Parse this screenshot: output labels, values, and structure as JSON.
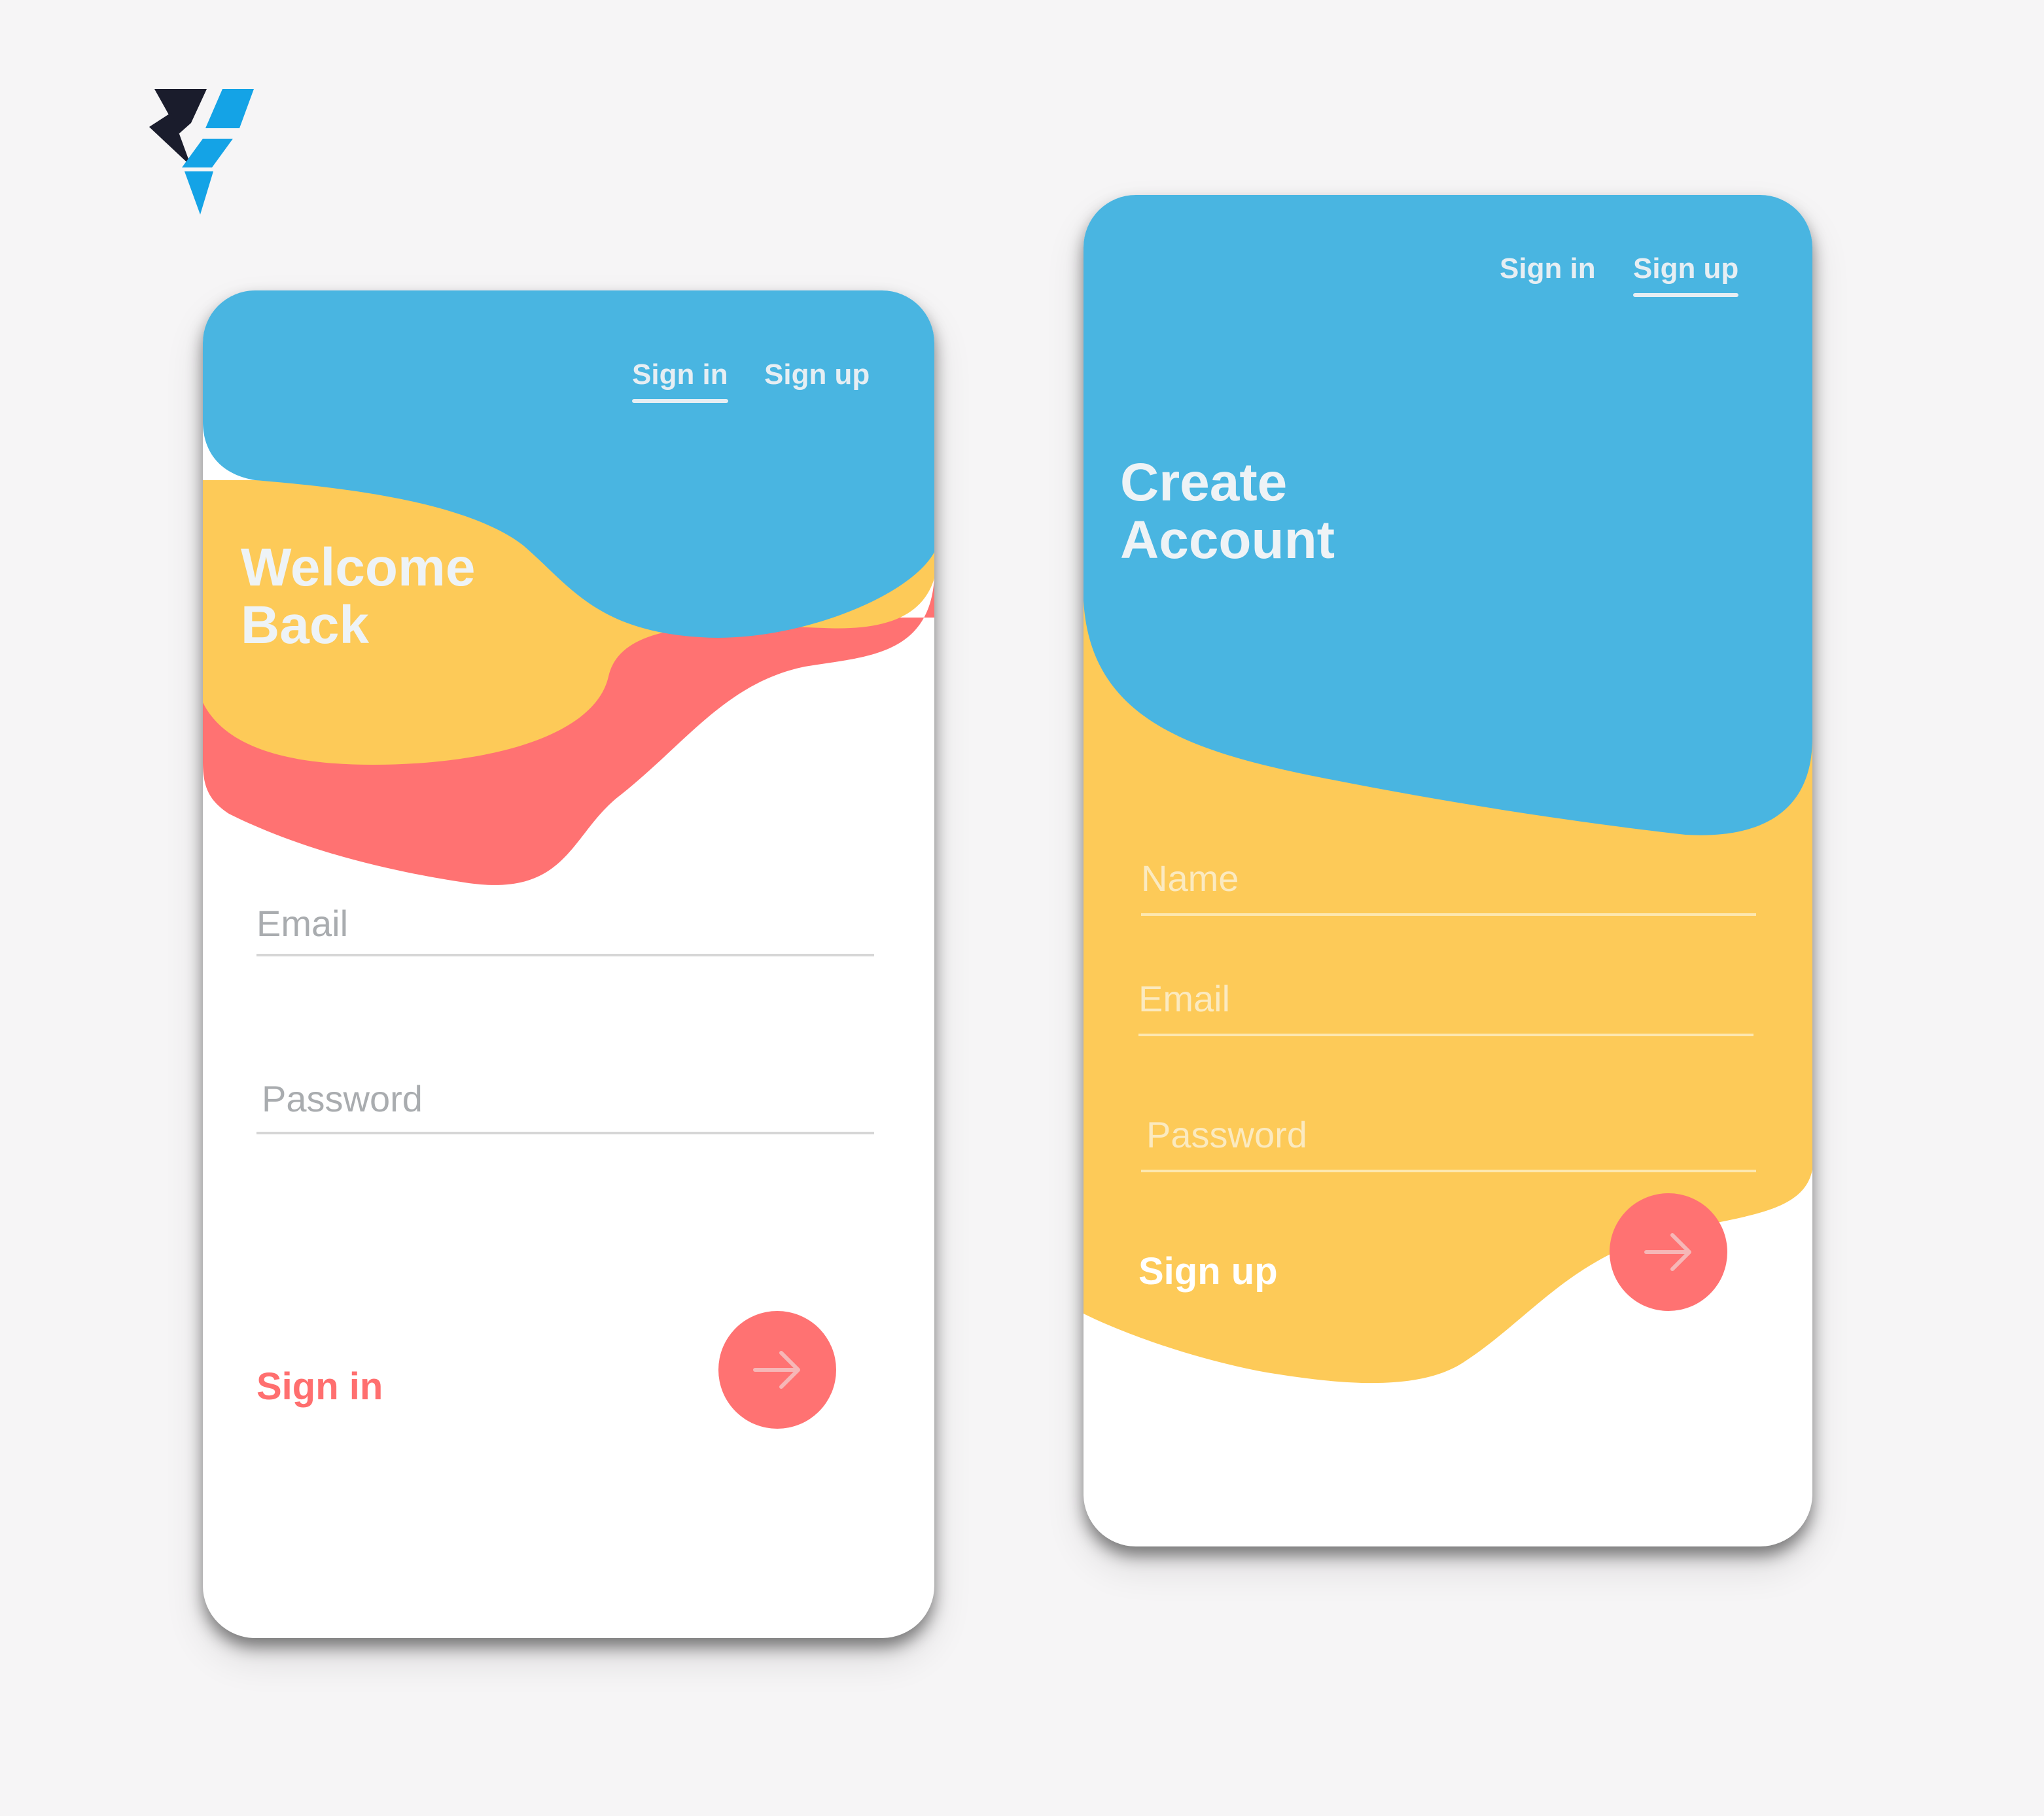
{
  "brand": {
    "logo_icon": "brand-logo-icon",
    "colors": {
      "dark": "#1a1c2c",
      "blue": "#14a3e6"
    }
  },
  "palette": {
    "blue": "#49b5e1",
    "yellow": "#fdca58",
    "coral": "#ff7272",
    "white": "#ffffff"
  },
  "signin_screen": {
    "nav": {
      "signin": "Sign in",
      "signup": "Sign up",
      "active": "signin"
    },
    "headline": [
      "Welcome",
      "Back"
    ],
    "email": {
      "placeholder": "Email",
      "value": ""
    },
    "password": {
      "placeholder": "Password",
      "value": ""
    },
    "action_label": "Sign in",
    "submit_icon": "arrow-right-icon"
  },
  "signup_screen": {
    "nav": {
      "signin": "Sign in",
      "signup": "Sign up",
      "active": "signup"
    },
    "headline": [
      "Create",
      "Account"
    ],
    "name": {
      "placeholder": "Name",
      "value": ""
    },
    "email": {
      "placeholder": "Email",
      "value": ""
    },
    "password": {
      "placeholder": "Password",
      "value": ""
    },
    "action_label": "Sign up",
    "submit_icon": "arrow-right-icon"
  }
}
